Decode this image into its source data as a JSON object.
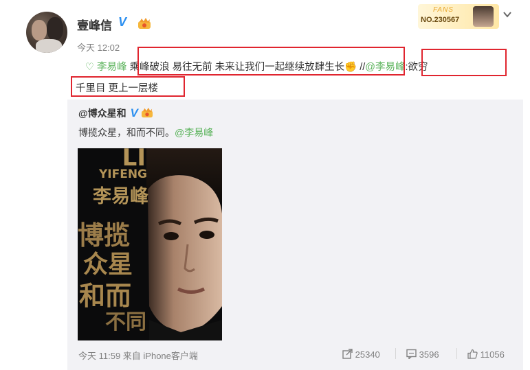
{
  "post": {
    "username": "壹峰信",
    "verified_mark": "V",
    "time": "今天 12:02",
    "fans_badge_title": "FANS",
    "fans_badge_no": "NO.230567",
    "text_link_prefix": "♡ 李易峰",
    "text_main": "乘峰破浪 易往无前 未来让我们一起继续放肆生长",
    "text_emoji": "✊",
    "text_separator": "//",
    "text_mention": "@李易峰",
    "text_colon_part": ":欲穷",
    "text_line2": "千里目 更上一层楼"
  },
  "quoted": {
    "username": "@博众星和",
    "verified_mark": "V",
    "text": "博揽众星，和而不同。",
    "mention": "@李易峰",
    "poster": {
      "top_en": "LI",
      "name_en": "YIFENG",
      "name_cn": "李易峰",
      "slogan_line1": "博揽",
      "slogan_line2": "众星",
      "slogan_line3": "和而",
      "slogan_line4": "不同"
    },
    "footer_time": "今天 11:59 来自 iPhone客户端",
    "reposts": "25340",
    "comments": "3596",
    "likes": "11056"
  },
  "colors": {
    "highlight_box": "#e0252f",
    "mention": "#eb7350",
    "green_link": "#5bb35b",
    "verified": "#2b8ff0",
    "card_bg": "#f2f2f5"
  }
}
